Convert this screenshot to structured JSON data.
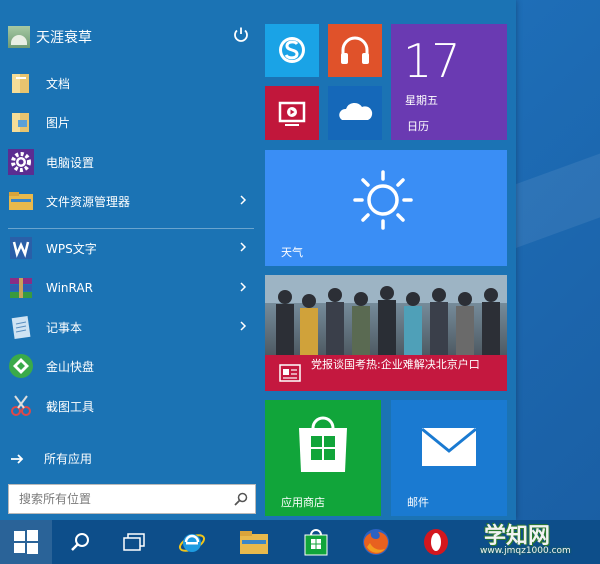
{
  "start_menu": {
    "user_name": "天涯衰草",
    "items": [
      {
        "label": "文档",
        "icon": "folder-docs-icon",
        "has_arrow": false
      },
      {
        "label": "图片",
        "icon": "folder-pictures-icon",
        "has_arrow": false
      },
      {
        "label": "电脑设置",
        "icon": "gear-icon",
        "has_arrow": false
      },
      {
        "label": "文件资源管理器",
        "icon": "file-explorer-icon",
        "has_arrow": true
      },
      {
        "label": "WPS文字",
        "icon": "wps-writer-icon",
        "has_arrow": true
      },
      {
        "label": "WinRAR",
        "icon": "winrar-icon",
        "has_arrow": true
      },
      {
        "label": "记事本",
        "icon": "notepad-icon",
        "has_arrow": true
      },
      {
        "label": "金山快盘",
        "icon": "kuaipan-icon",
        "has_arrow": false
      },
      {
        "label": "截图工具",
        "icon": "snipping-tool-icon",
        "has_arrow": false
      }
    ],
    "all_apps_label": "所有应用",
    "search_placeholder": "搜索所有位置"
  },
  "tiles": {
    "calendar_date": "17",
    "calendar_weekday": "星期五",
    "calendar_label": "日历",
    "weather_label": "天气",
    "news_headline": "党报谈国考热:企业难解决北京户口",
    "store_label": "应用商店",
    "mail_label": "邮件"
  },
  "taskbar": {
    "apps": [
      "start-icon",
      "search-icon",
      "task-view-icon",
      "internet-explorer-icon",
      "file-explorer-icon",
      "store-icon",
      "firefox-icon",
      "opera-icon"
    ]
  },
  "watermark": {
    "title": "学知网",
    "url": "www.jmqz1000.com"
  },
  "colors": {
    "menu_bg": "#1b73b4",
    "taskbar_bg": "#0d4e8a",
    "skype": "#1aa3e6",
    "music": "#e0522a",
    "video": "#c1173b",
    "onedrive": "#1568b9",
    "calendar": "#6a3ab2",
    "weather": "#3a8ef5",
    "news": "#c4183f",
    "store": "#11a53a",
    "mail": "#1a7ad1"
  }
}
